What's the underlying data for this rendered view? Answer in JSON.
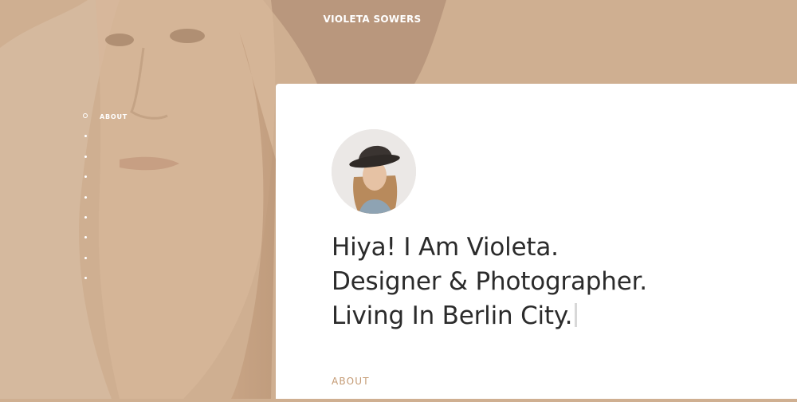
{
  "site": {
    "title": "VIOLETA SOWERS"
  },
  "side_nav": {
    "items": [
      {
        "label": "ABOUT",
        "active": true
      },
      {
        "label": "",
        "active": false
      },
      {
        "label": "",
        "active": false
      },
      {
        "label": "",
        "active": false
      },
      {
        "label": "",
        "active": false
      },
      {
        "label": "",
        "active": false
      },
      {
        "label": "",
        "active": false
      },
      {
        "label": "",
        "active": false
      },
      {
        "label": "",
        "active": false
      }
    ]
  },
  "hero": {
    "lines": [
      "Hiya! I Am Violeta.",
      "Designer & Photographer.",
      "Living In Berlin City."
    ]
  },
  "section": {
    "label": "ABOUT"
  },
  "colors": {
    "background": "#cfaf91",
    "card": "#ffffff",
    "accent": "#c49a73",
    "text": "#2b2b2b"
  }
}
